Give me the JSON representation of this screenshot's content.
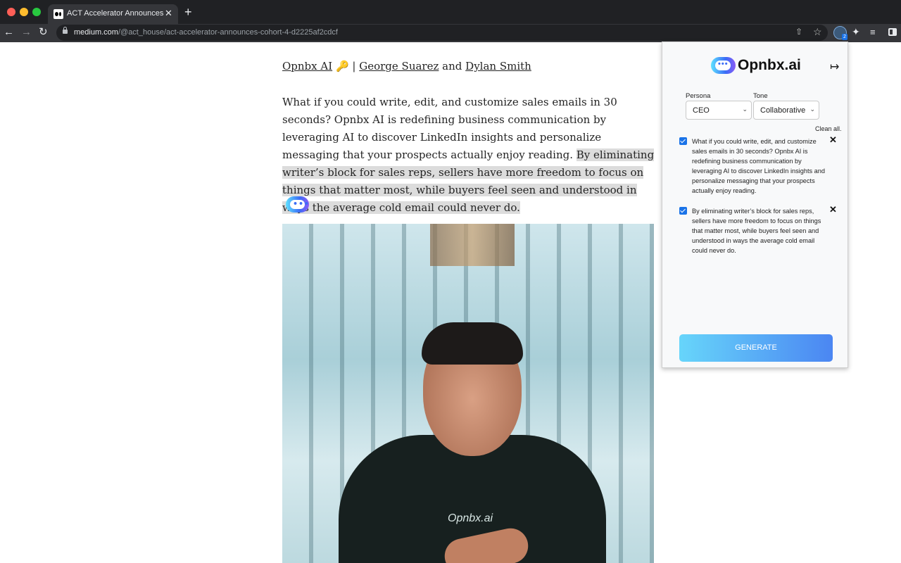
{
  "browser": {
    "tab_title": "ACT Accelerator Announces Cο",
    "tab_close": "✕",
    "new_tab": "+",
    "url_domain": "medium.com",
    "url_path": "/@act_house/act-accelerator-announces-cohort-4-d2225af2cdcf",
    "extension_badge": "2"
  },
  "article": {
    "byline": {
      "company": "Opnbx AI",
      "key_emoji": "🔑",
      "separator": "|",
      "author1": "George Suarez",
      "and": "and",
      "author2": "Dylan Smith"
    },
    "para_plain": "What if you could write, edit, and customize sales emails in 30 seconds? Opnbx AI is redefining business communication by leveraging AI to discover LinkedIn insights and personalize messaging that your prospects actually enjoy reading.",
    "para_highlight": "By eliminating writer’s block for sales reps, sellers have more freedom to focus on things that matter most, while buyers feel seen and understood in ways the average cold email could never do.",
    "photo_shirt_logo": "Opnbx.ai"
  },
  "panel": {
    "brand": "Opnbx.ai",
    "bubble_dots": "•••",
    "persona_label": "Persona",
    "persona_value": "CEO",
    "tone_label": "Tone",
    "tone_value": "Collaborative",
    "clean_all": "Clean all.",
    "items": [
      {
        "checked": true,
        "text": "What if you could write, edit, and customize sales emails in 30 seconds? Opnbx AI is redefining business communication by leveraging AI to discover LinkedIn insights and personalize messaging that your prospects actually enjoy reading."
      },
      {
        "checked": true,
        "text": "By eliminating writer’s block for sales reps, sellers have more freedom to focus on things that matter most, while buyers feel seen and understood in ways the average cold email could never do."
      }
    ],
    "generate_label": "GENERATE"
  },
  "colors": {
    "brand_gradient_start": "#67d5fa",
    "brand_gradient_end": "#4b86f2",
    "checkbox": "#1a73e8",
    "highlight": "#dcdcdc"
  }
}
